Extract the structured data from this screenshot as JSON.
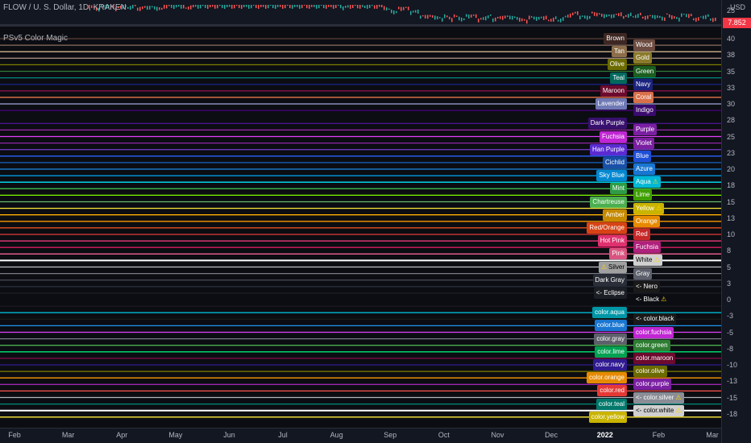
{
  "chart": {
    "title": "FLOW / U. S. Dollar, 1D, KRAKEN",
    "indicator_title": "PSv5 Color Magic",
    "currency": "USD",
    "current_price": "7.852",
    "price_top_tick": "25"
  },
  "time_axis": [
    "Feb",
    "Mar",
    "Apr",
    "May",
    "Jun",
    "Jul",
    "Aug",
    "Sep",
    "Oct",
    "Nov",
    "Dec",
    "2022",
    "Feb",
    "Mar"
  ],
  "y_axis_ticks": [
    {
      "value": 40,
      "label": "40"
    },
    {
      "value": 37.5,
      "label": "38"
    },
    {
      "value": 35,
      "label": "35"
    },
    {
      "value": 32.5,
      "label": "33"
    },
    {
      "value": 30,
      "label": "30"
    },
    {
      "value": 27.5,
      "label": "28"
    },
    {
      "value": 25,
      "label": "25"
    },
    {
      "value": 22.5,
      "label": "23"
    },
    {
      "value": 20,
      "label": "20"
    },
    {
      "value": 17.5,
      "label": "18"
    },
    {
      "value": 15,
      "label": "15"
    },
    {
      "value": 12.5,
      "label": "13"
    },
    {
      "value": 10,
      "label": "10"
    },
    {
      "value": 7.5,
      "label": "8"
    },
    {
      "value": 5,
      "label": "5"
    },
    {
      "value": 2.5,
      "label": "3"
    },
    {
      "value": 0,
      "label": "0"
    },
    {
      "value": -2.5,
      "label": "-3"
    },
    {
      "value": -5,
      "label": "-5"
    },
    {
      "value": -7.5,
      "label": "-8"
    },
    {
      "value": -10,
      "label": "-10"
    },
    {
      "value": -12.5,
      "label": "-13"
    },
    {
      "value": -15,
      "label": "-15"
    },
    {
      "value": -17.5,
      "label": "-18"
    }
  ],
  "color_lines": [
    {
      "value": 40,
      "color": "#5d4037"
    },
    {
      "value": 39,
      "color": "#8d6e63"
    },
    {
      "value": 38,
      "color": "#d2b48c"
    },
    {
      "value": 37,
      "color": "#a1887f"
    },
    {
      "value": 36,
      "color": "#808000"
    },
    {
      "value": 35,
      "color": "#2e7d32"
    },
    {
      "value": 34,
      "color": "#00897b"
    },
    {
      "value": 33,
      "color": "#1a237e"
    },
    {
      "value": 32,
      "color": "#880e4f"
    },
    {
      "value": 31,
      "color": "#ff7f50"
    },
    {
      "value": 30,
      "color": "#9fa8da"
    },
    {
      "value": 29,
      "color": "#4b0082"
    },
    {
      "value": 27,
      "color": "#4a148c"
    },
    {
      "value": 26,
      "color": "#9c27b0"
    },
    {
      "value": 25,
      "color": "#e040fb"
    },
    {
      "value": 24,
      "color": "#8e24aa"
    },
    {
      "value": 23,
      "color": "#673ab7"
    },
    {
      "value": 22,
      "color": "#2962ff"
    },
    {
      "value": 21,
      "color": "#1565c0"
    },
    {
      "value": 20,
      "color": "#1e88e5"
    },
    {
      "value": 19,
      "color": "#03a9f4"
    },
    {
      "value": 18,
      "color": "#00e5ff"
    },
    {
      "value": 17,
      "color": "#3fb950"
    },
    {
      "value": 16,
      "color": "#7fff00"
    },
    {
      "value": 15,
      "color": "#66bb6a"
    },
    {
      "value": 14,
      "color": "#ffeb3b"
    },
    {
      "value": 13,
      "color": "#ffb300"
    },
    {
      "value": 12,
      "color": "#ff9800"
    },
    {
      "value": 11,
      "color": "#ff5722"
    },
    {
      "value": 10,
      "color": "#e53935"
    },
    {
      "value": 9,
      "color": "#ff4081"
    },
    {
      "value": 8,
      "color": "#d81b60"
    },
    {
      "value": 7,
      "color": "#f06292"
    },
    {
      "value": 6,
      "color": "#ffffff"
    },
    {
      "value": 5,
      "color": "#c0c0c0"
    },
    {
      "value": 4,
      "color": "#787b86"
    },
    {
      "value": 3,
      "color": "#434651"
    },
    {
      "value": 2,
      "color": "#2a2e39"
    },
    {
      "value": 1,
      "color": "#1c1f26"
    },
    {
      "value": 0,
      "color": "#0b0d12"
    },
    {
      "value": -2,
      "color": "#00bcd4"
    },
    {
      "value": -3,
      "color": "#1a1a1a"
    },
    {
      "value": -4,
      "color": "#2196f3"
    },
    {
      "value": -5,
      "color": "#e040fb"
    },
    {
      "value": -6,
      "color": "#787b86"
    },
    {
      "value": -7,
      "color": "#4caf50"
    },
    {
      "value": -8,
      "color": "#00e676"
    },
    {
      "value": -9,
      "color": "#880e4f"
    },
    {
      "value": -10,
      "color": "#311b92"
    },
    {
      "value": -11,
      "color": "#808000"
    },
    {
      "value": -12,
      "color": "#ff9800"
    },
    {
      "value": -13,
      "color": "#9c27b0"
    },
    {
      "value": -14,
      "color": "#ff5252"
    },
    {
      "value": -15,
      "color": "#b2b5be"
    },
    {
      "value": -16,
      "color": "#00897b"
    },
    {
      "value": -17,
      "color": "#ffffff"
    },
    {
      "value": -18,
      "color": "#ffeb3b"
    }
  ],
  "labels_left": [
    {
      "text": "Brown",
      "value": 40,
      "bg": "#3e2723"
    },
    {
      "text": "Tan",
      "value": 38,
      "bg": "#8d6e4a"
    },
    {
      "text": "Olive",
      "value": 36,
      "bg": "#6b6b00"
    },
    {
      "text": "Teal",
      "value": 34,
      "bg": "#00695c"
    },
    {
      "text": "Maroon",
      "value": 32,
      "bg": "#6d0a2e"
    },
    {
      "text": "Lavender",
      "value": 30,
      "bg": "#6f79b5"
    },
    {
      "text": "Dark Purple",
      "value": 27,
      "bg": "#38106e"
    },
    {
      "text": "Fuchsia",
      "value": 25,
      "bg": "#c026d3"
    },
    {
      "text": "Han Purple",
      "value": 23,
      "bg": "#5b2bd1"
    },
    {
      "text": "Cichlid",
      "value": 21,
      "bg": "#1950a8"
    },
    {
      "text": "Sky Blue",
      "value": 19,
      "bg": "#0288d1"
    },
    {
      "text": "Mint",
      "value": 17,
      "bg": "#2e9d46"
    },
    {
      "text": "Chartreuse",
      "value": 15,
      "bg": "#4caf50"
    },
    {
      "text": "Amber",
      "value": 13,
      "bg": "#c68a00"
    },
    {
      "text": "Red/Orange",
      "value": 11,
      "bg": "#d84315"
    },
    {
      "text": "Hot Pink",
      "value": 9,
      "bg": "#e0306e"
    },
    {
      "text": "Pink",
      "value": 7,
      "bg": "#d9537f"
    },
    {
      "text": "Silver",
      "value": 5,
      "bg": "#a0a0a0",
      "warn": true,
      "warn_first": true
    },
    {
      "text": "Dark Gray",
      "value": 3,
      "bg": "#2a2e39"
    },
    {
      "text": "<- Eclipse",
      "value": 1,
      "bg": "#1c1f26"
    },
    {
      "text": "color.aqua",
      "value": -2,
      "bg": "#0097a7"
    },
    {
      "text": "color.blue",
      "value": -4,
      "bg": "#1976d2"
    },
    {
      "text": "color.gray",
      "value": -6,
      "bg": "#5d606b"
    },
    {
      "text": "color.lime",
      "value": -8,
      "bg": "#00a152"
    },
    {
      "text": "color.navy",
      "value": -10,
      "bg": "#311b92"
    },
    {
      "text": "color.orange",
      "value": -12,
      "bg": "#e68a00"
    },
    {
      "text": "color.red",
      "value": -14,
      "bg": "#e53935"
    },
    {
      "text": "color.teal",
      "value": -16,
      "bg": "#00796b"
    },
    {
      "text": "color.yellow",
      "value": -18,
      "bg": "#c9b400"
    }
  ],
  "labels_right": [
    {
      "text": "Wood",
      "value": 39,
      "bg": "#6d4c41"
    },
    {
      "text": "Gold",
      "value": 37,
      "bg": "#8a7a2a"
    },
    {
      "text": "Green",
      "value": 35,
      "bg": "#1b5e20"
    },
    {
      "text": "Navy",
      "value": 33,
      "bg": "#1a237e"
    },
    {
      "text": "Coral",
      "value": 31,
      "bg": "#d9704a"
    },
    {
      "text": "Indigo",
      "value": 29,
      "bg": "#3a0a6e"
    },
    {
      "text": "Purple",
      "value": 26,
      "bg": "#7b1fa2"
    },
    {
      "text": "Violet",
      "value": 24,
      "bg": "#7b1fa2"
    },
    {
      "text": "Blue",
      "value": 22,
      "bg": "#1e4fd8"
    },
    {
      "text": "Azure",
      "value": 20,
      "bg": "#1976d2"
    },
    {
      "text": "Aqua",
      "value": 18,
      "bg": "#00b8d4",
      "warn": true
    },
    {
      "text": "Lime",
      "value": 16,
      "bg": "#3f9f00"
    },
    {
      "text": "Yellow",
      "value": 14,
      "bg": "#c9b400",
      "warn": true
    },
    {
      "text": "Orange",
      "value": 12,
      "bg": "#e68a00"
    },
    {
      "text": "Red",
      "value": 10,
      "bg": "#c62828"
    },
    {
      "text": "Fuchsia",
      "value": 8,
      "bg": "#b0207d"
    },
    {
      "text": "White",
      "value": 6,
      "bg": "#d0d0d0",
      "warn": true
    },
    {
      "text": "Gray",
      "value": 4,
      "bg": "#5d606b"
    },
    {
      "text": "<- Nero",
      "value": 2,
      "bg": "#1a1a1a"
    },
    {
      "text": "<- Black",
      "value": 0,
      "bg": "#0b0d12",
      "warn": true
    },
    {
      "text": "<- color.black",
      "value": -3,
      "bg": "#1a1a1a"
    },
    {
      "text": "color.fuchsia",
      "value": -5,
      "bg": "#c026d3"
    },
    {
      "text": "color.green",
      "value": -7,
      "bg": "#2e7d32"
    },
    {
      "text": "color.maroon",
      "value": -9,
      "bg": "#6d0a2e"
    },
    {
      "text": "color.olive",
      "value": -11,
      "bg": "#6b6b00"
    },
    {
      "text": "color.purple",
      "value": -13,
      "bg": "#7b1fa2"
    },
    {
      "text": "<- color.silver",
      "value": -15,
      "bg": "#8a8d96",
      "warn": true
    },
    {
      "text": "<- color.white",
      "value": -17,
      "bg": "#d0d0d0",
      "warn": true
    }
  ],
  "warning_glyph": "⚠"
}
